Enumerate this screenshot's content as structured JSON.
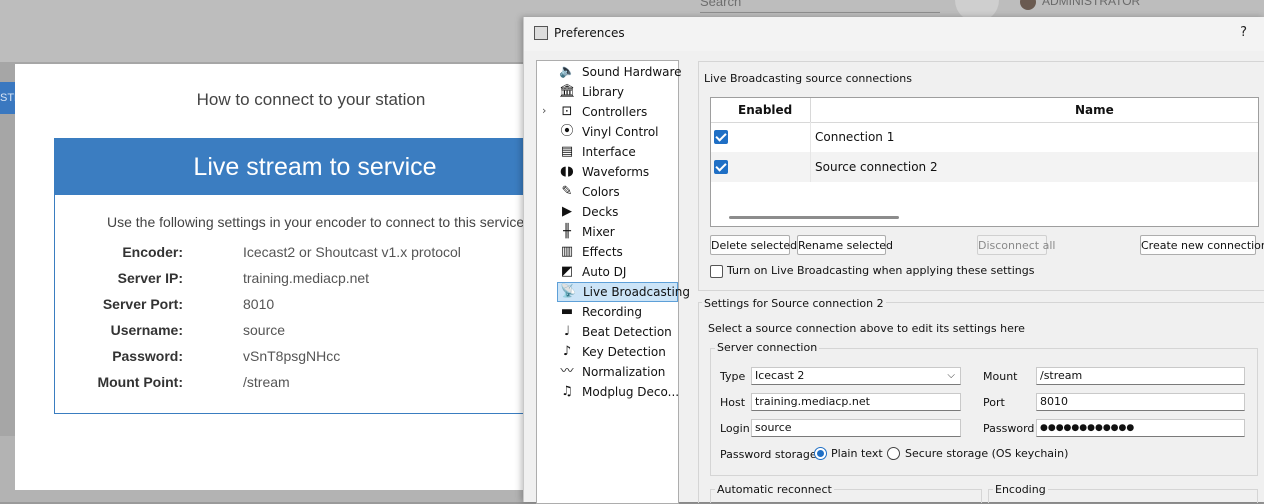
{
  "background": {
    "search_placeholder": "Search",
    "admin_label": "ADMINISTRATOR",
    "tab_fragment": "STE"
  },
  "modal": {
    "title": "How to connect to your station",
    "panel_title": "Live stream to service",
    "description": "Use the following settings in your encoder to connect to this service.",
    "fields": [
      {
        "label": "Encoder:",
        "value": "Icecast2 or Shoutcast v1.x protocol"
      },
      {
        "label": "Server IP:",
        "value": "training.mediacp.net"
      },
      {
        "label": "Server Port:",
        "value": "8010"
      },
      {
        "label": "Username:",
        "value": "source"
      },
      {
        "label": "Password:",
        "value": "vSnT8psgNHcc"
      },
      {
        "label": "Mount Point:",
        "value": "/stream"
      }
    ]
  },
  "prefs": {
    "title": "Preferences",
    "help": "?",
    "sidebar": [
      {
        "label": "Sound Hardware",
        "icon": "speaker-icon",
        "glyph": "🔈"
      },
      {
        "label": "Library",
        "icon": "library-icon",
        "glyph": "🏛"
      },
      {
        "label": "Controllers",
        "icon": "controller-icon",
        "glyph": "⊡",
        "expandable": true
      },
      {
        "label": "Vinyl Control",
        "icon": "vinyl-icon",
        "glyph": "⦿"
      },
      {
        "label": "Interface",
        "icon": "interface-icon",
        "glyph": "▤"
      },
      {
        "label": "Waveforms",
        "icon": "waveform-icon",
        "glyph": "◖◗"
      },
      {
        "label": "Colors",
        "icon": "colors-icon",
        "glyph": "✎"
      },
      {
        "label": "Decks",
        "icon": "deck-icon",
        "glyph": "▶"
      },
      {
        "label": "Mixer",
        "icon": "mixer-icon",
        "glyph": "╫"
      },
      {
        "label": "Effects",
        "icon": "effects-icon",
        "glyph": "▥"
      },
      {
        "label": "Auto DJ",
        "icon": "autodj-icon",
        "glyph": "◩"
      },
      {
        "label": "Live Broadcasting",
        "icon": "broadcast-icon",
        "glyph": "📡",
        "selected": true
      },
      {
        "label": "Recording",
        "icon": "recording-icon",
        "glyph": "▬"
      },
      {
        "label": "Beat Detection",
        "icon": "beat-icon",
        "glyph": "♩"
      },
      {
        "label": "Key Detection",
        "icon": "key-icon",
        "glyph": "♪"
      },
      {
        "label": "Normalization",
        "icon": "normalization-icon",
        "glyph": "〰"
      },
      {
        "label": "Modplug Deco...",
        "icon": "modplug-icon",
        "glyph": "♫"
      }
    ],
    "connections": {
      "group_label": "Live Broadcasting source connections",
      "col_enabled": "Enabled",
      "col_name": "Name",
      "rows": [
        {
          "name": "Connection 1",
          "enabled": true
        },
        {
          "name": "Source connection 2",
          "enabled": true
        }
      ],
      "btn_delete": "Delete selected",
      "btn_rename": "Rename selected",
      "btn_disconnect": "Disconnect all",
      "btn_create": "Create new connection",
      "turn_on_label": "Turn on Live Broadcasting when applying these settings"
    },
    "settings": {
      "group_label": "Settings for Source connection 2",
      "hint": "Select a source connection above to edit its settings here",
      "server_group": "Server connection",
      "type_label": "Type",
      "type_value": "Icecast 2",
      "mount_label": "Mount",
      "mount_value": "/stream",
      "host_label": "Host",
      "host_value": "training.mediacp.net",
      "port_label": "Port",
      "port_value": "8010",
      "login_label": "Login",
      "login_value": "source",
      "password_label": "Password",
      "password_value": "●●●●●●●●●●●●",
      "storage_label": "Password storage",
      "storage_plain": "Plain text",
      "storage_secure": "Secure storage (OS keychain)",
      "auto_reconnect": "Automatic reconnect",
      "encoding": "Encoding"
    },
    "accent_color": "#1f6fc5"
  }
}
